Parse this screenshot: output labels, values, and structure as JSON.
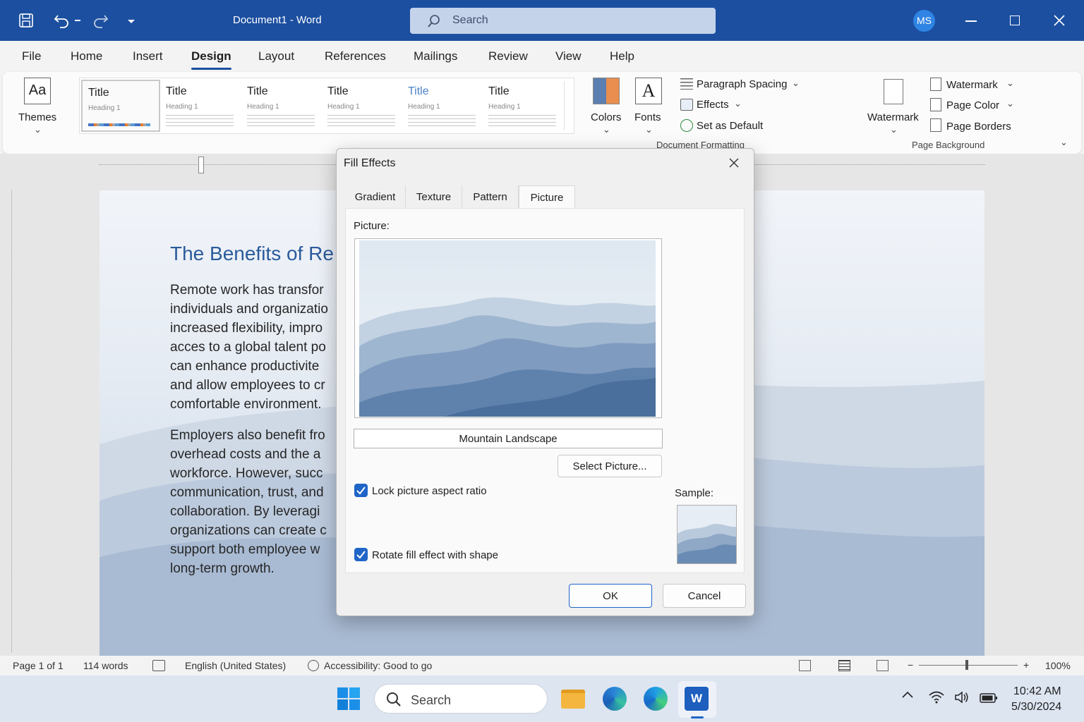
{
  "titlebar": {
    "title": "Document1  -  Word",
    "search_placeholder": "Search",
    "user_initials": "MS"
  },
  "tabs": [
    "File",
    "Home",
    "Insert",
    "Design",
    "Layout",
    "References",
    "Mailings",
    "Review",
    "View",
    "Help"
  ],
  "active_tab": "Design",
  "ribbon": {
    "themes_label": "Themes",
    "style_gallery": [
      {
        "title": "Title",
        "heading": "Heading 1"
      },
      {
        "title": "Title",
        "heading": "Heading 1"
      },
      {
        "title": "Title",
        "heading": "Heading 1"
      },
      {
        "title": "Title",
        "heading": "Heading 1"
      },
      {
        "title": "Title",
        "heading": "Heading 1"
      },
      {
        "title": "Title",
        "heading": "Heading 1"
      }
    ],
    "colors_label": "Colors",
    "fonts_label": "Fonts",
    "paragraph_spacing_label": "Paragraph Spacing",
    "effects_label": "Effects",
    "set_default_label": "Set as Default",
    "group_document_formatting": "Document Formatting",
    "watermark_big_label": "Watermark",
    "watermark_label": "Watermark",
    "page_color_label": "Page Color",
    "page_borders_label": "Page Borders",
    "group_page_background": "Page Background"
  },
  "document": {
    "title": "The Benefits of Re",
    "para1": "Remote work has transfor\nindividuals and organizatio\nincreased flexibility, impro\nacces to a global talent po\ncan enhance productivite\nand allow employees to cr\ncomfortable environment.",
    "para2": "Employers also benefit fro\noverhead costs and the a\nworkforce. However, succ\ncommunication, trust, and\ncollaboration. By leveragi\norganizations can create c\nsupport both employee w\nlong-term growth."
  },
  "dialog": {
    "title": "Fill Effects",
    "tabs": [
      "Gradient",
      "Texture",
      "Pattern",
      "Picture"
    ],
    "active_tab": "Picture",
    "picture_label": "Picture:",
    "picture_name": "Mountain Landscape",
    "select_picture_label": "Select Picture...",
    "lock_aspect_label": "Lock picture aspect ratio",
    "lock_aspect_checked": true,
    "rotate_fill_label": "Rotate fill effect with shape",
    "rotate_fill_checked": true,
    "sample_label": "Sample:",
    "ok_label": "OK",
    "cancel_label": "Cancel"
  },
  "statusbar": {
    "page": "Page 1 of 1",
    "words": "114 words",
    "language": "English (United States)",
    "accessibility": "Accessibility: Good to go",
    "zoom": "100%"
  },
  "taskbar": {
    "search_placeholder": "Search",
    "time": "10:42 AM",
    "date": "5/30/2024"
  },
  "colors": {
    "title_bar": "#1c4fa0",
    "accent": "#1f65c8",
    "doc_heading": "#2a5b9b"
  }
}
